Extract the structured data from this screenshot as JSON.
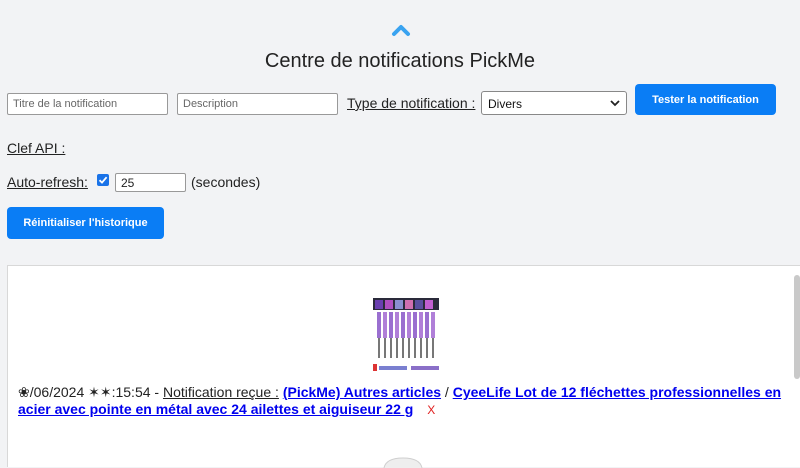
{
  "header": {
    "title": "Centre de notifications PickMe",
    "chevron_color": "#3aa3f0"
  },
  "form": {
    "title_placeholder": "Titre de la notification",
    "description_placeholder": "Description",
    "type_label": "Type de notification :",
    "type_selected": "Divers",
    "test_button": "Tester la notification",
    "api_label": "Clef API :",
    "autorefresh_label": "Auto-refresh:",
    "autorefresh_checked": true,
    "autorefresh_value": "25",
    "seconds_label": "(secondes)",
    "reset_button": "Réinitialiser l'historique",
    "accent_color": "#0a7df5"
  },
  "notifications": [
    {
      "date": "❀/06/2024",
      "time": "✶✶:15:54",
      "separator": " - ",
      "received_label": "Notification reçue :",
      "category_link": "(PickMe) Autres articles",
      "slash": " / ",
      "product_link": "CyeeLife Lot de 12 fléchettes professionnelles en acier avec pointe en métal avec 24 ailettes et aiguiseur 22 g",
      "delete": "X"
    }
  ]
}
